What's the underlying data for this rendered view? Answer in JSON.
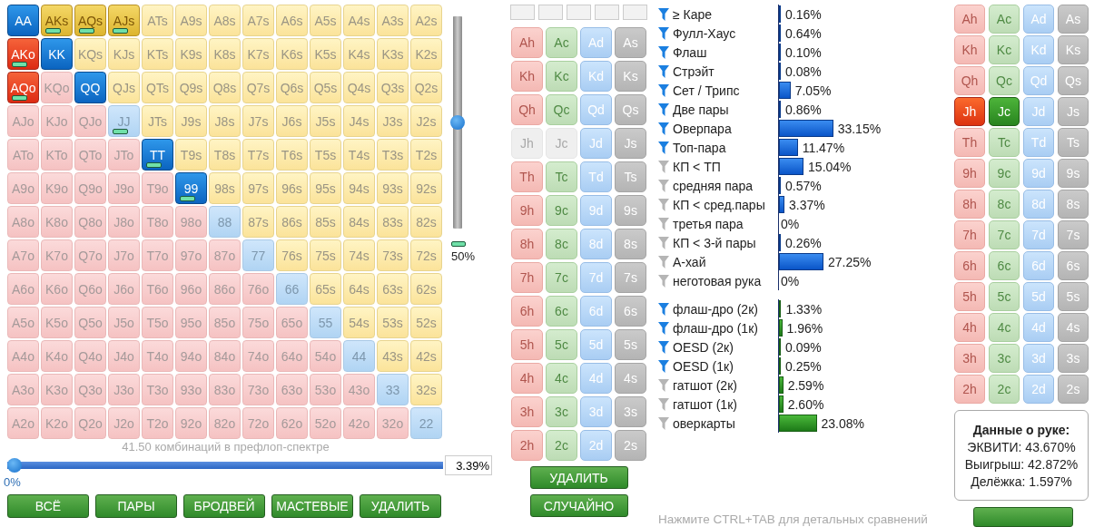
{
  "range": {
    "rows": [
      [
        {
          "label": "AA",
          "selected": true,
          "weighted": false
        },
        {
          "label": "AKs",
          "selected": true,
          "weighted": true
        },
        {
          "label": "AQs",
          "selected": true,
          "weighted": true
        },
        {
          "label": "AJs",
          "selected": true,
          "weighted": true
        },
        {
          "label": "ATs",
          "selected": false,
          "weighted": false
        },
        {
          "label": "A9s",
          "selected": false,
          "weighted": false
        },
        {
          "label": "A8s",
          "selected": false,
          "weighted": false
        },
        {
          "label": "A7s",
          "selected": false,
          "weighted": false
        },
        {
          "label": "A6s",
          "selected": false,
          "weighted": false
        },
        {
          "label": "A5s",
          "selected": false,
          "weighted": false
        },
        {
          "label": "A4s",
          "selected": false,
          "weighted": false
        },
        {
          "label": "A3s",
          "selected": false,
          "weighted": false
        },
        {
          "label": "A2s",
          "selected": false,
          "weighted": false
        }
      ],
      [
        {
          "label": "AKo",
          "selected": true,
          "weighted": true
        },
        {
          "label": "KK",
          "selected": true,
          "weighted": false
        },
        {
          "label": "KQs",
          "selected": false,
          "weighted": false
        },
        {
          "label": "KJs",
          "selected": false,
          "weighted": false
        },
        {
          "label": "KTs",
          "selected": false,
          "weighted": false
        },
        {
          "label": "K9s",
          "selected": false,
          "weighted": false
        },
        {
          "label": "K8s",
          "selected": false,
          "weighted": false
        },
        {
          "label": "K7s",
          "selected": false,
          "weighted": false
        },
        {
          "label": "K6s",
          "selected": false,
          "weighted": false
        },
        {
          "label": "K5s",
          "selected": false,
          "weighted": false
        },
        {
          "label": "K4s",
          "selected": false,
          "weighted": false
        },
        {
          "label": "K3s",
          "selected": false,
          "weighted": false
        },
        {
          "label": "K2s",
          "selected": false,
          "weighted": false
        }
      ],
      [
        {
          "label": "AQo",
          "selected": true,
          "weighted": true
        },
        {
          "label": "KQo",
          "selected": false,
          "weighted": false
        },
        {
          "label": "QQ",
          "selected": true,
          "weighted": false
        },
        {
          "label": "QJs",
          "selected": false,
          "weighted": false
        },
        {
          "label": "QTs",
          "selected": false,
          "weighted": false
        },
        {
          "label": "Q9s",
          "selected": false,
          "weighted": false
        },
        {
          "label": "Q8s",
          "selected": false,
          "weighted": false
        },
        {
          "label": "Q7s",
          "selected": false,
          "weighted": false
        },
        {
          "label": "Q6s",
          "selected": false,
          "weighted": false
        },
        {
          "label": "Q5s",
          "selected": false,
          "weighted": false
        },
        {
          "label": "Q4s",
          "selected": false,
          "weighted": false
        },
        {
          "label": "Q3s",
          "selected": false,
          "weighted": false
        },
        {
          "label": "Q2s",
          "selected": false,
          "weighted": false
        }
      ],
      [
        {
          "label": "AJo",
          "selected": false,
          "weighted": false
        },
        {
          "label": "KJo",
          "selected": false,
          "weighted": false
        },
        {
          "label": "QJo",
          "selected": false,
          "weighted": false
        },
        {
          "label": "JJ",
          "selected": false,
          "weighted": true
        },
        {
          "label": "JTs",
          "selected": false,
          "weighted": false
        },
        {
          "label": "J9s",
          "selected": false,
          "weighted": false
        },
        {
          "label": "J8s",
          "selected": false,
          "weighted": false
        },
        {
          "label": "J7s",
          "selected": false,
          "weighted": false
        },
        {
          "label": "J6s",
          "selected": false,
          "weighted": false
        },
        {
          "label": "J5s",
          "selected": false,
          "weighted": false
        },
        {
          "label": "J4s",
          "selected": false,
          "weighted": false
        },
        {
          "label": "J3s",
          "selected": false,
          "weighted": false
        },
        {
          "label": "J2s",
          "selected": false,
          "weighted": false
        }
      ],
      [
        {
          "label": "ATo",
          "selected": false,
          "weighted": false
        },
        {
          "label": "KTo",
          "selected": false,
          "weighted": false
        },
        {
          "label": "QTo",
          "selected": false,
          "weighted": false
        },
        {
          "label": "JTo",
          "selected": false,
          "weighted": false
        },
        {
          "label": "TT",
          "selected": true,
          "weighted": true
        },
        {
          "label": "T9s",
          "selected": false,
          "weighted": false
        },
        {
          "label": "T8s",
          "selected": false,
          "weighted": false
        },
        {
          "label": "T7s",
          "selected": false,
          "weighted": false
        },
        {
          "label": "T6s",
          "selected": false,
          "weighted": false
        },
        {
          "label": "T5s",
          "selected": false,
          "weighted": false
        },
        {
          "label": "T4s",
          "selected": false,
          "weighted": false
        },
        {
          "label": "T3s",
          "selected": false,
          "weighted": false
        },
        {
          "label": "T2s",
          "selected": false,
          "weighted": false
        }
      ],
      [
        {
          "label": "A9o",
          "selected": false,
          "weighted": false
        },
        {
          "label": "K9o",
          "selected": false,
          "weighted": false
        },
        {
          "label": "Q9o",
          "selected": false,
          "weighted": false
        },
        {
          "label": "J9o",
          "selected": false,
          "weighted": false
        },
        {
          "label": "T9o",
          "selected": false,
          "weighted": false
        },
        {
          "label": "99",
          "selected": true,
          "weighted": true
        },
        {
          "label": "98s",
          "selected": false,
          "weighted": false
        },
        {
          "label": "97s",
          "selected": false,
          "weighted": false
        },
        {
          "label": "96s",
          "selected": false,
          "weighted": false
        },
        {
          "label": "95s",
          "selected": false,
          "weighted": false
        },
        {
          "label": "94s",
          "selected": false,
          "weighted": false
        },
        {
          "label": "93s",
          "selected": false,
          "weighted": false
        },
        {
          "label": "92s",
          "selected": false,
          "weighted": false
        }
      ],
      [
        {
          "label": "A8o",
          "selected": false,
          "weighted": false
        },
        {
          "label": "K8o",
          "selected": false,
          "weighted": false
        },
        {
          "label": "Q8o",
          "selected": false,
          "weighted": false
        },
        {
          "label": "J8o",
          "selected": false,
          "weighted": false
        },
        {
          "label": "T8o",
          "selected": false,
          "weighted": false
        },
        {
          "label": "98o",
          "selected": false,
          "weighted": false
        },
        {
          "label": "88",
          "selected": false,
          "weighted": false
        },
        {
          "label": "87s",
          "selected": false,
          "weighted": false
        },
        {
          "label": "86s",
          "selected": false,
          "weighted": false
        },
        {
          "label": "85s",
          "selected": false,
          "weighted": false
        },
        {
          "label": "84s",
          "selected": false,
          "weighted": false
        },
        {
          "label": "83s",
          "selected": false,
          "weighted": false
        },
        {
          "label": "82s",
          "selected": false,
          "weighted": false
        }
      ],
      [
        {
          "label": "A7o",
          "selected": false,
          "weighted": false
        },
        {
          "label": "K7o",
          "selected": false,
          "weighted": false
        },
        {
          "label": "Q7o",
          "selected": false,
          "weighted": false
        },
        {
          "label": "J7o",
          "selected": false,
          "weighted": false
        },
        {
          "label": "T7o",
          "selected": false,
          "weighted": false
        },
        {
          "label": "97o",
          "selected": false,
          "weighted": false
        },
        {
          "label": "87o",
          "selected": false,
          "weighted": false
        },
        {
          "label": "77",
          "selected": false,
          "weighted": false
        },
        {
          "label": "76s",
          "selected": false,
          "weighted": false
        },
        {
          "label": "75s",
          "selected": false,
          "weighted": false
        },
        {
          "label": "74s",
          "selected": false,
          "weighted": false
        },
        {
          "label": "73s",
          "selected": false,
          "weighted": false
        },
        {
          "label": "72s",
          "selected": false,
          "weighted": false
        }
      ],
      [
        {
          "label": "A6o",
          "selected": false,
          "weighted": false
        },
        {
          "label": "K6o",
          "selected": false,
          "weighted": false
        },
        {
          "label": "Q6o",
          "selected": false,
          "weighted": false
        },
        {
          "label": "J6o",
          "selected": false,
          "weighted": false
        },
        {
          "label": "T6o",
          "selected": false,
          "weighted": false
        },
        {
          "label": "96o",
          "selected": false,
          "weighted": false
        },
        {
          "label": "86o",
          "selected": false,
          "weighted": false
        },
        {
          "label": "76o",
          "selected": false,
          "weighted": false
        },
        {
          "label": "66",
          "selected": false,
          "weighted": false
        },
        {
          "label": "65s",
          "selected": false,
          "weighted": false
        },
        {
          "label": "64s",
          "selected": false,
          "weighted": false
        },
        {
          "label": "63s",
          "selected": false,
          "weighted": false
        },
        {
          "label": "62s",
          "selected": false,
          "weighted": false
        }
      ],
      [
        {
          "label": "A5o",
          "selected": false,
          "weighted": false
        },
        {
          "label": "K5o",
          "selected": false,
          "weighted": false
        },
        {
          "label": "Q5o",
          "selected": false,
          "weighted": false
        },
        {
          "label": "J5o",
          "selected": false,
          "weighted": false
        },
        {
          "label": "T5o",
          "selected": false,
          "weighted": false
        },
        {
          "label": "95o",
          "selected": false,
          "weighted": false
        },
        {
          "label": "85o",
          "selected": false,
          "weighted": false
        },
        {
          "label": "75o",
          "selected": false,
          "weighted": false
        },
        {
          "label": "65o",
          "selected": false,
          "weighted": false
        },
        {
          "label": "55",
          "selected": false,
          "weighted": false
        },
        {
          "label": "54s",
          "selected": false,
          "weighted": false
        },
        {
          "label": "53s",
          "selected": false,
          "weighted": false
        },
        {
          "label": "52s",
          "selected": false,
          "weighted": false
        }
      ],
      [
        {
          "label": "A4o",
          "selected": false,
          "weighted": false
        },
        {
          "label": "K4o",
          "selected": false,
          "weighted": false
        },
        {
          "label": "Q4o",
          "selected": false,
          "weighted": false
        },
        {
          "label": "J4o",
          "selected": false,
          "weighted": false
        },
        {
          "label": "T4o",
          "selected": false,
          "weighted": false
        },
        {
          "label": "94o",
          "selected": false,
          "weighted": false
        },
        {
          "label": "84o",
          "selected": false,
          "weighted": false
        },
        {
          "label": "74o",
          "selected": false,
          "weighted": false
        },
        {
          "label": "64o",
          "selected": false,
          "weighted": false
        },
        {
          "label": "54o",
          "selected": false,
          "weighted": false
        },
        {
          "label": "44",
          "selected": false,
          "weighted": false
        },
        {
          "label": "43s",
          "selected": false,
          "weighted": false
        },
        {
          "label": "42s",
          "selected": false,
          "weighted": false
        }
      ],
      [
        {
          "label": "A3o",
          "selected": false,
          "weighted": false
        },
        {
          "label": "K3o",
          "selected": false,
          "weighted": false
        },
        {
          "label": "Q3o",
          "selected": false,
          "weighted": false
        },
        {
          "label": "J3o",
          "selected": false,
          "weighted": false
        },
        {
          "label": "T3o",
          "selected": false,
          "weighted": false
        },
        {
          "label": "93o",
          "selected": false,
          "weighted": false
        },
        {
          "label": "83o",
          "selected": false,
          "weighted": false
        },
        {
          "label": "73o",
          "selected": false,
          "weighted": false
        },
        {
          "label": "63o",
          "selected": false,
          "weighted": false
        },
        {
          "label": "53o",
          "selected": false,
          "weighted": false
        },
        {
          "label": "43o",
          "selected": false,
          "weighted": false
        },
        {
          "label": "33",
          "selected": false,
          "weighted": false
        },
        {
          "label": "32s",
          "selected": false,
          "weighted": false
        }
      ],
      [
        {
          "label": "A2o",
          "selected": false,
          "weighted": false
        },
        {
          "label": "K2o",
          "selected": false,
          "weighted": false
        },
        {
          "label": "Q2o",
          "selected": false,
          "weighted": false
        },
        {
          "label": "J2o",
          "selected": false,
          "weighted": false
        },
        {
          "label": "T2o",
          "selected": false,
          "weighted": false
        },
        {
          "label": "92o",
          "selected": false,
          "weighted": false
        },
        {
          "label": "82o",
          "selected": false,
          "weighted": false
        },
        {
          "label": "72o",
          "selected": false,
          "weighted": false
        },
        {
          "label": "62o",
          "selected": false,
          "weighted": false
        },
        {
          "label": "52o",
          "selected": false,
          "weighted": false
        },
        {
          "label": "42o",
          "selected": false,
          "weighted": false
        },
        {
          "label": "32o",
          "selected": false,
          "weighted": false
        },
        {
          "label": "22",
          "selected": false,
          "weighted": false
        }
      ]
    ],
    "weight_slider": {
      "level": 0.5,
      "reading": "50%"
    },
    "caption": "41.50 комбинаций в префлоп-спектре",
    "range_slider": {
      "level": 0,
      "reading": "0%",
      "value": "3.39%"
    },
    "buttons": [
      "ВСЁ",
      "ПАРЫ",
      "БРОДВЕЙ",
      "МАСТЕВЫЕ",
      "УДАЛИТЬ"
    ]
  },
  "board": {
    "deck": [
      [
        {
          "label": "Ah",
          "selected": false,
          "disabled": false
        },
        {
          "label": "Ac",
          "selected": false,
          "disabled": false
        },
        {
          "label": "Ad",
          "selected": false,
          "disabled": false
        },
        {
          "label": "As",
          "selected": false,
          "disabled": false
        }
      ],
      [
        {
          "label": "Kh",
          "selected": false,
          "disabled": false
        },
        {
          "label": "Kc",
          "selected": false,
          "disabled": false
        },
        {
          "label": "Kd",
          "selected": false,
          "disabled": false
        },
        {
          "label": "Ks",
          "selected": false,
          "disabled": false
        }
      ],
      [
        {
          "label": "Qh",
          "selected": false,
          "disabled": false
        },
        {
          "label": "Qc",
          "selected": false,
          "disabled": false
        },
        {
          "label": "Qd",
          "selected": false,
          "disabled": false
        },
        {
          "label": "Qs",
          "selected": false,
          "disabled": false
        }
      ],
      [
        {
          "label": "Jh",
          "selected": false,
          "disabled": true
        },
        {
          "label": "Jc",
          "selected": false,
          "disabled": true
        },
        {
          "label": "Jd",
          "selected": false,
          "disabled": false
        },
        {
          "label": "Js",
          "selected": false,
          "disabled": false
        }
      ],
      [
        {
          "label": "Th",
          "selected": false,
          "disabled": false
        },
        {
          "label": "Tc",
          "selected": false,
          "disabled": false
        },
        {
          "label": "Td",
          "selected": false,
          "disabled": false
        },
        {
          "label": "Ts",
          "selected": false,
          "disabled": false
        }
      ],
      [
        {
          "label": "9h",
          "selected": false,
          "disabled": false
        },
        {
          "label": "9c",
          "selected": false,
          "disabled": false
        },
        {
          "label": "9d",
          "selected": false,
          "disabled": false
        },
        {
          "label": "9s",
          "selected": false,
          "disabled": false
        }
      ],
      [
        {
          "label": "8h",
          "selected": false,
          "disabled": false
        },
        {
          "label": "8c",
          "selected": false,
          "disabled": false
        },
        {
          "label": "8d",
          "selected": false,
          "disabled": false
        },
        {
          "label": "8s",
          "selected": false,
          "disabled": false
        }
      ],
      [
        {
          "label": "7h",
          "selected": false,
          "disabled": false
        },
        {
          "label": "7c",
          "selected": false,
          "disabled": false
        },
        {
          "label": "7d",
          "selected": false,
          "disabled": false
        },
        {
          "label": "7s",
          "selected": false,
          "disabled": false
        }
      ],
      [
        {
          "label": "6h",
          "selected": false,
          "disabled": false
        },
        {
          "label": "6c",
          "selected": false,
          "disabled": false
        },
        {
          "label": "6d",
          "selected": false,
          "disabled": false
        },
        {
          "label": "6s",
          "selected": false,
          "disabled": false
        }
      ],
      [
        {
          "label": "5h",
          "selected": false,
          "disabled": false
        },
        {
          "label": "5c",
          "selected": false,
          "disabled": false
        },
        {
          "label": "5d",
          "selected": false,
          "disabled": false
        },
        {
          "label": "5s",
          "selected": false,
          "disabled": false
        }
      ],
      [
        {
          "label": "4h",
          "selected": false,
          "disabled": false
        },
        {
          "label": "4c",
          "selected": false,
          "disabled": false
        },
        {
          "label": "4d",
          "selected": false,
          "disabled": false
        },
        {
          "label": "4s",
          "selected": false,
          "disabled": false
        }
      ],
      [
        {
          "label": "3h",
          "selected": false,
          "disabled": false
        },
        {
          "label": "3c",
          "selected": false,
          "disabled": false
        },
        {
          "label": "3d",
          "selected": false,
          "disabled": false
        },
        {
          "label": "3s",
          "selected": false,
          "disabled": false
        }
      ],
      [
        {
          "label": "2h",
          "selected": false,
          "disabled": false
        },
        {
          "label": "2c",
          "selected": false,
          "disabled": false
        },
        {
          "label": "2d",
          "selected": false,
          "disabled": false
        },
        {
          "label": "2s",
          "selected": false,
          "disabled": false
        }
      ]
    ],
    "buttons": [
      "УДАЛИТЬ",
      "СЛУЧАЙНО"
    ]
  },
  "stats": {
    "made_hands": [
      {
        "label": "≥ Каре",
        "filter": true,
        "level": 0.0016,
        "value": "0.16%"
      },
      {
        "label": "Фулл-Хаус",
        "filter": true,
        "level": 0.0064,
        "value": "0.64%"
      },
      {
        "label": "Флаш",
        "filter": true,
        "level": 0.001,
        "value": "0.10%"
      },
      {
        "label": "Стрэйт",
        "filter": true,
        "level": 0.0008,
        "value": "0.08%"
      },
      {
        "label": "Сет / Трипс",
        "filter": true,
        "level": 0.0705,
        "value": "7.05%"
      },
      {
        "label": "Две пары",
        "filter": true,
        "level": 0.0086,
        "value": "0.86%"
      },
      {
        "label": "Оверпара",
        "filter": true,
        "level": 0.3315,
        "value": "33.15%"
      },
      {
        "label": "Топ-пара",
        "filter": true,
        "level": 0.1147,
        "value": "11.47%"
      },
      {
        "label": "КП < ТП",
        "filter": false,
        "level": 0.1504,
        "value": "15.04%"
      },
      {
        "label": "средняя пара",
        "filter": false,
        "level": 0.0057,
        "value": "0.57%"
      },
      {
        "label": "КП < сред.пары",
        "filter": false,
        "level": 0.0337,
        "value": "3.37%"
      },
      {
        "label": "третья пара",
        "filter": false,
        "level": 0,
        "value": "0%"
      },
      {
        "label": "КП < 3-й пары",
        "filter": false,
        "level": 0.0026,
        "value": "0.26%"
      },
      {
        "label": "А-хай",
        "filter": false,
        "level": 0.2725,
        "value": "27.25%"
      },
      {
        "label": "неготовая рука",
        "filter": false,
        "level": 0,
        "value": "0%"
      }
    ],
    "draws": [
      {
        "label": "флаш-дро (2к)",
        "filter": true,
        "level": 0.0133,
        "value": "1.33%"
      },
      {
        "label": "флаш-дро (1к)",
        "filter": true,
        "level": 0.0196,
        "value": "1.96%"
      },
      {
        "label": "OESD (2к)",
        "filter": true,
        "level": 0.0009,
        "value": "0.09%"
      },
      {
        "label": "OESD (1к)",
        "filter": true,
        "level": 0.0025,
        "value": "0.25%"
      },
      {
        "label": "гатшот (2к)",
        "filter": false,
        "level": 0.0259,
        "value": "2.59%"
      },
      {
        "label": "гатшот (1к)",
        "filter": false,
        "level": 0.026,
        "value": "2.60%"
      },
      {
        "label": "оверкарты",
        "filter": false,
        "level": 0.2308,
        "value": "23.08%"
      }
    ],
    "hint": "Нажмите CTRL+TAB для детальных сравнений"
  },
  "hand": {
    "deck": [
      [
        {
          "label": "Ah",
          "selected": false,
          "disabled": false
        },
        {
          "label": "Ac",
          "selected": false,
          "disabled": false
        },
        {
          "label": "Ad",
          "selected": false,
          "disabled": false
        },
        {
          "label": "As",
          "selected": false,
          "disabled": false
        }
      ],
      [
        {
          "label": "Kh",
          "selected": false,
          "disabled": false
        },
        {
          "label": "Kc",
          "selected": false,
          "disabled": false
        },
        {
          "label": "Kd",
          "selected": false,
          "disabled": false
        },
        {
          "label": "Ks",
          "selected": false,
          "disabled": false
        }
      ],
      [
        {
          "label": "Qh",
          "selected": false,
          "disabled": false
        },
        {
          "label": "Qc",
          "selected": false,
          "disabled": false
        },
        {
          "label": "Qd",
          "selected": false,
          "disabled": false
        },
        {
          "label": "Qs",
          "selected": false,
          "disabled": false
        }
      ],
      [
        {
          "label": "Jh",
          "selected": true,
          "disabled": false
        },
        {
          "label": "Jc",
          "selected": true,
          "disabled": false
        },
        {
          "label": "Jd",
          "selected": false,
          "disabled": false
        },
        {
          "label": "Js",
          "selected": false,
          "disabled": false
        }
      ],
      [
        {
          "label": "Th",
          "selected": false,
          "disabled": false
        },
        {
          "label": "Tc",
          "selected": false,
          "disabled": false
        },
        {
          "label": "Td",
          "selected": false,
          "disabled": false
        },
        {
          "label": "Ts",
          "selected": false,
          "disabled": false
        }
      ],
      [
        {
          "label": "9h",
          "selected": false,
          "disabled": false
        },
        {
          "label": "9c",
          "selected": false,
          "disabled": false
        },
        {
          "label": "9d",
          "selected": false,
          "disabled": false
        },
        {
          "label": "9s",
          "selected": false,
          "disabled": false
        }
      ],
      [
        {
          "label": "8h",
          "selected": false,
          "disabled": false
        },
        {
          "label": "8c",
          "selected": false,
          "disabled": false
        },
        {
          "label": "8d",
          "selected": false,
          "disabled": false
        },
        {
          "label": "8s",
          "selected": false,
          "disabled": false
        }
      ],
      [
        {
          "label": "7h",
          "selected": false,
          "disabled": false
        },
        {
          "label": "7c",
          "selected": false,
          "disabled": false
        },
        {
          "label": "7d",
          "selected": false,
          "disabled": false
        },
        {
          "label": "7s",
          "selected": false,
          "disabled": false
        }
      ],
      [
        {
          "label": "6h",
          "selected": false,
          "disabled": false
        },
        {
          "label": "6c",
          "selected": false,
          "disabled": false
        },
        {
          "label": "6d",
          "selected": false,
          "disabled": false
        },
        {
          "label": "6s",
          "selected": false,
          "disabled": false
        }
      ],
      [
        {
          "label": "5h",
          "selected": false,
          "disabled": false
        },
        {
          "label": "5c",
          "selected": false,
          "disabled": false
        },
        {
          "label": "5d",
          "selected": false,
          "disabled": false
        },
        {
          "label": "5s",
          "selected": false,
          "disabled": false
        }
      ],
      [
        {
          "label": "4h",
          "selected": false,
          "disabled": false
        },
        {
          "label": "4c",
          "selected": false,
          "disabled": false
        },
        {
          "label": "4d",
          "selected": false,
          "disabled": false
        },
        {
          "label": "4s",
          "selected": false,
          "disabled": false
        }
      ],
      [
        {
          "label": "3h",
          "selected": false,
          "disabled": false
        },
        {
          "label": "3c",
          "selected": false,
          "disabled": false
        },
        {
          "label": "3d",
          "selected": false,
          "disabled": false
        },
        {
          "label": "3s",
          "selected": false,
          "disabled": false
        }
      ],
      [
        {
          "label": "2h",
          "selected": false,
          "disabled": false
        },
        {
          "label": "2c",
          "selected": false,
          "disabled": false
        },
        {
          "label": "2d",
          "selected": false,
          "disabled": false
        },
        {
          "label": "2s",
          "selected": false,
          "disabled": false
        }
      ]
    ],
    "info": {
      "title": "Данные о руке:",
      "lines": [
        "ЭКВИТИ: 43.670%",
        "Выигрыш: 42.872%",
        "Делёжка: 1.597%"
      ]
    }
  }
}
